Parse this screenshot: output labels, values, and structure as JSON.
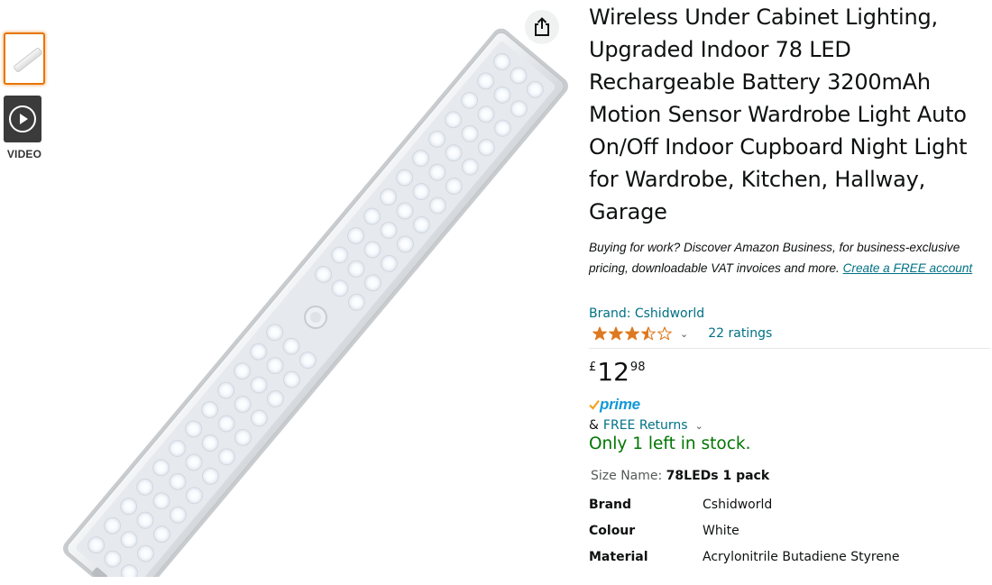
{
  "gallery": {
    "video_label": "VIDEO"
  },
  "product": {
    "title": "Wireless Under Cabinet Lighting, Upgraded Indoor 78 LED Rechargeable Battery 3200mAh Motion Sensor Wardrobe Light Auto On/Off Indoor Cupboard Night Light for Wardrobe, Kitchen, Hallway, Garage",
    "business_text": "Buying for work? Discover Amazon Business, for business-exclusive pricing, downloadable VAT invoices and more.",
    "business_link": "Create a FREE account",
    "brand_link": "Brand: Cshidworld",
    "rating_value": 3.5,
    "ratings_count": "22 ratings",
    "price": {
      "currency": "£",
      "whole": "12",
      "fraction": "98"
    },
    "prime_label": "prime",
    "returns_prefix": "&",
    "returns_link": "FREE Returns",
    "stock": "Only 1 left in stock.",
    "size_label": "Size Name:",
    "size_value": "78LEDs 1 pack",
    "specs": [
      {
        "key": "Brand",
        "value": "Cshidworld"
      },
      {
        "key": "Colour",
        "value": "White"
      },
      {
        "key": "Material",
        "value": "Acrylonitrile Butadiene Styrene"
      }
    ]
  },
  "icons": {
    "share": "share-icon",
    "play": "play-icon",
    "star": "star-icon",
    "chevron": "chevron-down-icon",
    "check": "checkmark-icon"
  },
  "colors": {
    "link": "#007185",
    "stock": "#007600",
    "star": "#de7921",
    "prime": "#1399d6",
    "thumb_selected": "#e77600"
  }
}
